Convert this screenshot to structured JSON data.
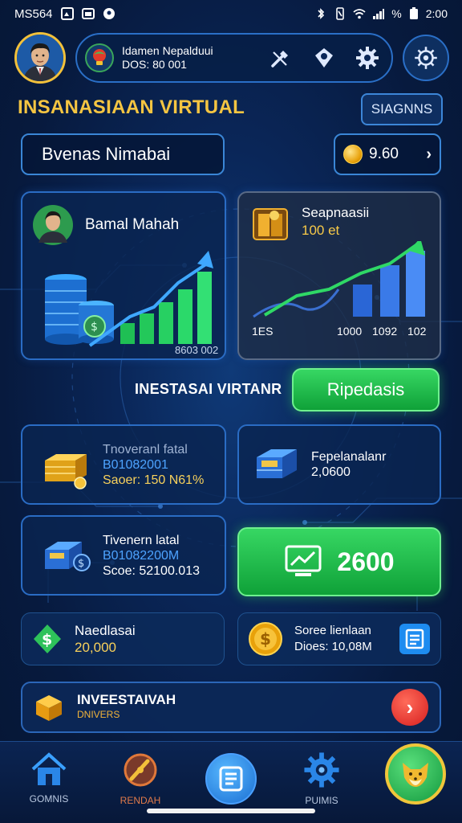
{
  "status_bar": {
    "carrier": "MS564",
    "battery_text": "%",
    "time": "2:00"
  },
  "header": {
    "profile_name": "Idamen Nepalduui",
    "profile_sub": "DOS: 80 001"
  },
  "title": "INSANASIAAN VIRTUAL",
  "signs_button": "SIAGNNS",
  "name_field": "Bvenas Nimabai",
  "coin_balance": "9.60",
  "card_left": {
    "title": "Bamal Mahah",
    "value": "8603 002"
  },
  "card_right": {
    "title": "Seapnaasii",
    "value": "100 et",
    "ticks": [
      "1ES",
      "1000",
      "1092",
      "102"
    ]
  },
  "invest_label": "INESTASAI VIRTANR",
  "lapor_button": "Ripedasis",
  "mid_cards": {
    "card1": {
      "title": "Tnoveranl fatal",
      "line2": "B01082001",
      "line3": "Saoer: 150 N61%"
    },
    "card2": {
      "title": "Fepelanalanr",
      "line2": "2,0600"
    },
    "card3": {
      "title": "Tivenern latal",
      "line2": "B01082200M",
      "line3": "Scoe: 52100.013"
    }
  },
  "total_button": "2600",
  "small_cards": {
    "left": {
      "title": "Naedlasai",
      "value": "20,000"
    },
    "right": {
      "title": "Soree lienlaan",
      "value": "Dioes: 10,08M"
    }
  },
  "banner": {
    "title": "INVEESTAIVAH",
    "subtitle": "DNIVERS"
  },
  "nav": {
    "items": [
      {
        "label": "GOMNIS"
      },
      {
        "label": "RENDAH"
      },
      {
        "label": ""
      },
      {
        "label": "PUIMIS"
      }
    ]
  },
  "colors": {
    "accent_yellow": "#f5c542",
    "accent_green": "#22c04f",
    "accent_blue": "#3a86d6",
    "background": "#0a2658"
  }
}
